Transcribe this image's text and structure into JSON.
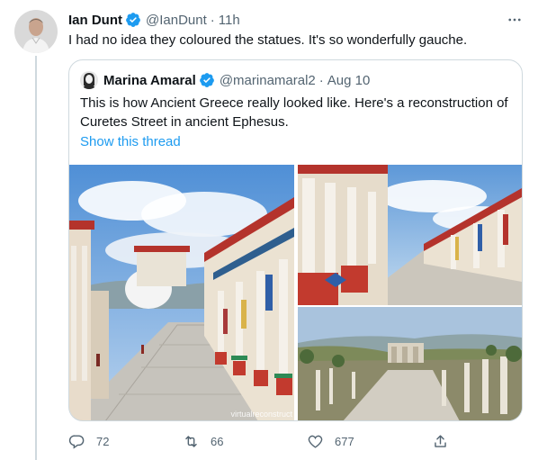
{
  "tweet": {
    "author_name": "Ian Dunt",
    "author_handle": "@IanDunt",
    "separator": "·",
    "time": "11h",
    "text": "I had no idea they coloured the statues. It's so wonderfully gauche."
  },
  "quoted": {
    "author_name": "Marina Amaral",
    "author_handle": "@marinamaral2",
    "separator": "·",
    "time": "Aug 10",
    "text": "This is how Ancient Greece really looked like. Here's a reconstruction of Curetes Street in ancient Ephesus.",
    "show_thread": "Show this thread",
    "media_watermark": "virtualreconstruct"
  },
  "actions": {
    "replies": "72",
    "retweets": "66",
    "likes": "677"
  },
  "colors": {
    "accent": "#1d9bf0",
    "secondary_text": "#536471",
    "border": "#cfd9de"
  },
  "icons": [
    "more-icon",
    "verified-badge-icon",
    "reply-icon",
    "retweet-icon",
    "like-icon",
    "share-icon"
  ]
}
